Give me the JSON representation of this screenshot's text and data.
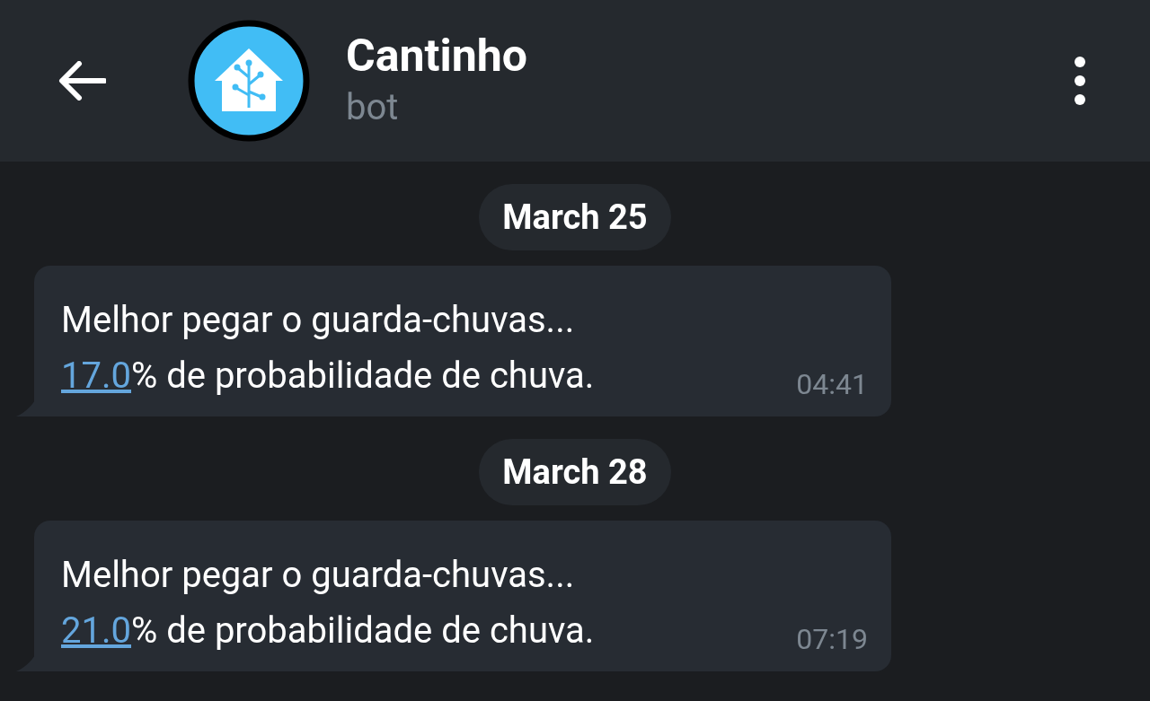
{
  "header": {
    "title": "Cantinho",
    "subtitle": "bot"
  },
  "messages": [
    {
      "date": "March 25",
      "line1": "Melhor pegar o guarda-chuvas...",
      "link": "17.0",
      "rest": "% de probabilidade de chuva.",
      "time": "04:41"
    },
    {
      "date": "March 28",
      "line1": "Melhor pegar o guarda-chuvas...",
      "link": "21.0",
      "rest": "% de probabilidade de chuva.",
      "time": "07:19"
    }
  ]
}
